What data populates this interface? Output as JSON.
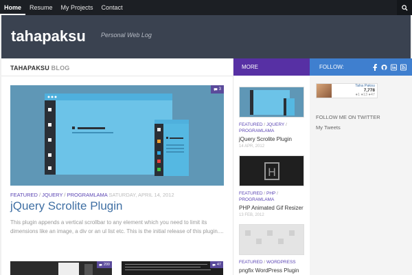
{
  "nav": {
    "items": [
      {
        "label": "Home",
        "active": true
      },
      {
        "label": "Resume",
        "active": false
      },
      {
        "label": "My Projects",
        "active": false
      },
      {
        "label": "Contact",
        "active": false
      }
    ],
    "search_icon": "search-icon"
  },
  "header": {
    "title": "tahapaksu",
    "tagline": "Personal Web Log"
  },
  "main": {
    "heading_brand": "TAHAPAKSU",
    "heading_section": "BLOG",
    "featured": {
      "comments": "3",
      "categories": [
        "FEATURED",
        "JQUERY",
        "PROGRAMLAMA"
      ],
      "date": "SATURDAY, APRIL 14, 2012",
      "title": "jQuery Scrolite Plugin",
      "excerpt": "This plugin appends a vertical scrollbar to any element which you need to limit its dimensions like an image, a div or an ul list etc. This is the initial release of this plugin...."
    },
    "thumbs": [
      {
        "comments": "200"
      },
      {
        "comments": "47"
      }
    ]
  },
  "more": {
    "label": "MORE",
    "posts": [
      {
        "categories": [
          "FEATURED",
          "JQUERY",
          "PROGRAMLAMA"
        ],
        "title": "jQuery Scrolite Plugin",
        "date": "14 APR, 2012"
      },
      {
        "categories": [
          "FEATURED",
          "PHP",
          "PROGRAMLAMA"
        ],
        "title": "PHP Animated Gif Resizer",
        "date": "13 FEB, 2012"
      },
      {
        "categories": [
          "FEATURED",
          "WORDPRESS"
        ],
        "title": "pngfix WordPress Plugin",
        "date": ""
      }
    ]
  },
  "follow": {
    "label": "FOLLOW:",
    "icons": [
      "facebook-icon",
      "github-icon",
      "linkedin-icon",
      "rss-icon"
    ],
    "badge": {
      "name": "Taha Paksu",
      "rep": "7,778",
      "tags": "●1 ●13 ●47"
    },
    "twitter_title": "FOLLOW ME ON TWITTER",
    "twitter_link": "My Tweets"
  },
  "colors": {
    "nav_bg": "#1c1f24",
    "header_bg": "#3a4250",
    "more_bg": "#5730a4",
    "follow_bg": "#3f7fcf",
    "accent_link": "#5a44b3",
    "title_blue": "#3f6fa3"
  }
}
